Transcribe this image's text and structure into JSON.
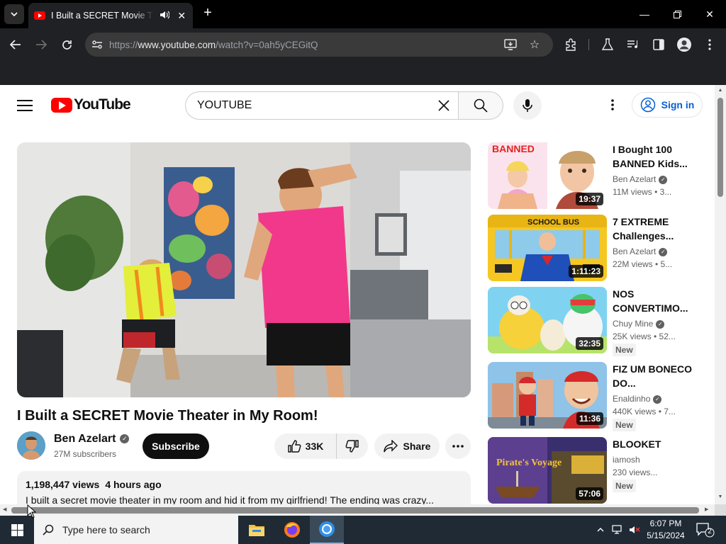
{
  "browser": {
    "tab_title": "I Built a SECRET Movie Theater in My Room!",
    "url_prefix": "https://",
    "url_host": "www.youtube.com",
    "url_path": "/watch?v=0ah5yCEGitQ"
  },
  "masthead": {
    "logo_text": "YouTube",
    "search_value": "YOUTUBE",
    "signin_label": "Sign in"
  },
  "video": {
    "title": "I Built a SECRET Movie Theater in My Room!",
    "channel": "Ben Azelart",
    "subscribers": "27M subscribers",
    "subscribe_label": "Subscribe",
    "likes": "33K",
    "share_label": "Share",
    "views": "1,198,447 views",
    "posted": "4 hours ago",
    "description": "I built a secret movie theater in my room and hid it from my girlfriend! The ending was crazy..."
  },
  "recommendations": [
    {
      "title": "I Bought 100 BANNED Kids...",
      "channel": "Ben Azelart",
      "verified": true,
      "stats": "11M views  • 3...",
      "duration": "19:37",
      "new": "",
      "thumb_text": "BANNED"
    },
    {
      "title": "7 EXTREME Challenges...",
      "channel": "Ben Azelart",
      "verified": true,
      "stats": "22M views  • 5...",
      "duration": "1:11:23",
      "new": "",
      "thumb_text": "SCHOOL BUS"
    },
    {
      "title": "NOS CONVERTIMO...",
      "channel": "Chuy Mine",
      "verified": true,
      "stats": "25K views  • 52...",
      "duration": "32:35",
      "new": "New",
      "thumb_text": ""
    },
    {
      "title": "FIZ UM BONECO DO...",
      "channel": "Enaldinho",
      "verified": true,
      "stats": "440K views  • 7...",
      "duration": "11:36",
      "new": "New",
      "thumb_text": ""
    },
    {
      "title": "BLOOKET",
      "channel": "iamosh",
      "verified": false,
      "stats": "230 views...",
      "duration": "57:06",
      "new": "New",
      "thumb_text": "Pirate's Voyage"
    }
  ],
  "taskbar": {
    "search_placeholder": "Type here to search",
    "time": "6:07 PM",
    "date": "5/15/2024",
    "notifications": "2"
  }
}
